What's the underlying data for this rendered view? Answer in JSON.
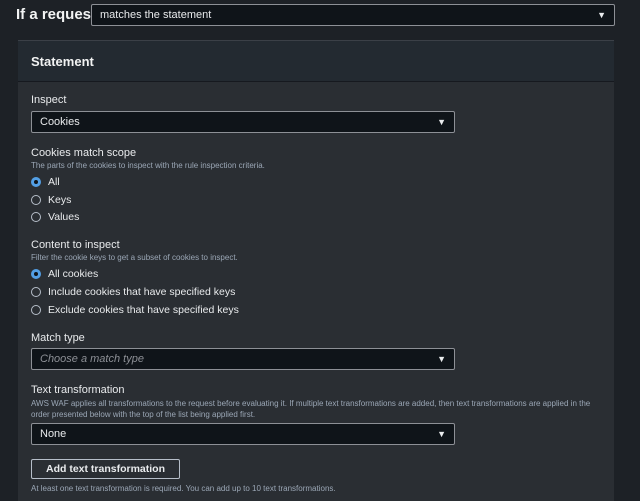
{
  "header": {
    "label": "If a request",
    "select_value": "matches the statement"
  },
  "statement": {
    "title": "Statement",
    "inspect": {
      "label": "Inspect",
      "value": "Cookies"
    },
    "cookies_scope": {
      "label": "Cookies match scope",
      "description": "The parts of the cookies to inspect with the rule inspection criteria.",
      "options": [
        "All",
        "Keys",
        "Values"
      ],
      "selected": "All"
    },
    "content": {
      "label": "Content to inspect",
      "description": "Filter the cookie keys to get a subset of cookies to inspect.",
      "options": [
        "All cookies",
        "Include cookies that have specified keys",
        "Exclude cookies that have specified keys"
      ],
      "selected": "All cookies"
    },
    "match_type": {
      "label": "Match type",
      "placeholder": "Choose a match type"
    },
    "text_transformation": {
      "label": "Text transformation",
      "description": "AWS WAF applies all transformations to the request before evaluating it. If multiple text transformations are added, then text transformations are applied in the order presented below with the top of the list being applied first.",
      "value": "None",
      "add_button": "Add text transformation",
      "footer_note": "At least one text transformation is required. You can add up to 10 text transformations."
    }
  }
}
